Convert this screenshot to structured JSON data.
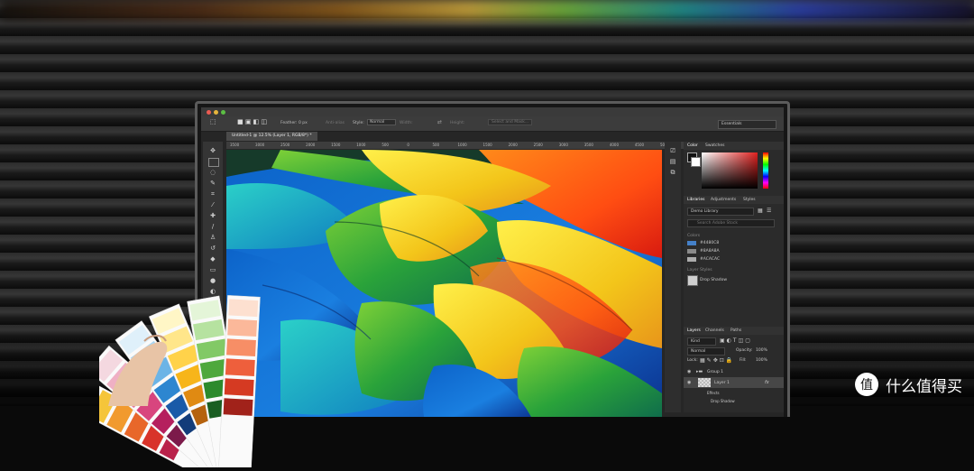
{
  "photoshop": {
    "options_bar": {
      "feather": "Feather: 0 px",
      "anti_alias": "Anti-alias",
      "style_label": "Style:",
      "style_value": "Normal",
      "width_label": "Width:",
      "height_label": "Height:",
      "select_mask": "Select and Mask...",
      "workspace": "Essentials"
    },
    "document_tab": "Untitled-1 @ 12.5% (Layer 1, RGB/8*) *",
    "ruler_ticks": [
      "3500",
      "3000",
      "2500",
      "2000",
      "1500",
      "1000",
      "500",
      "0",
      "500",
      "1000",
      "1500",
      "2000",
      "2500",
      "3000",
      "3500",
      "4000",
      "4500",
      "5000"
    ],
    "color_panel": {
      "tabs": [
        "Color",
        "Swatches"
      ]
    },
    "libraries_panel": {
      "tabs": [
        "Libraries",
        "Adjustments",
        "Styles"
      ],
      "library_select": "Demo Library",
      "search_placeholder": "Search Adobe Stock",
      "colors_heading": "Colors",
      "colors": [
        {
          "label": "#4480C8",
          "hex": "#4480C8"
        },
        {
          "label": "#8A8A8A",
          "hex": "#8A8A8A"
        },
        {
          "label": "#ACACAC",
          "hex": "#ACACAC"
        }
      ],
      "layer_styles_heading": "Layer Styles",
      "layer_style_item": "Drop Shadow"
    },
    "layers_panel": {
      "tabs": [
        "Layers",
        "Channels",
        "Paths"
      ],
      "kind_filter": "Kind",
      "blend_mode": "Normal",
      "opacity_label": "Opacity:",
      "opacity_value": "100%",
      "lock_label": "Lock:",
      "fill_label": "Fill:",
      "fill_value": "100%",
      "layers": [
        {
          "name": "Group 1"
        },
        {
          "name": "Layer 1"
        },
        {
          "name": "Effects"
        },
        {
          "name": "Drop Shadow"
        }
      ]
    }
  },
  "watermark": {
    "text": "什么值得买"
  },
  "colors": {
    "ps_bg": "#262626",
    "accent_red": "#e0211f"
  }
}
